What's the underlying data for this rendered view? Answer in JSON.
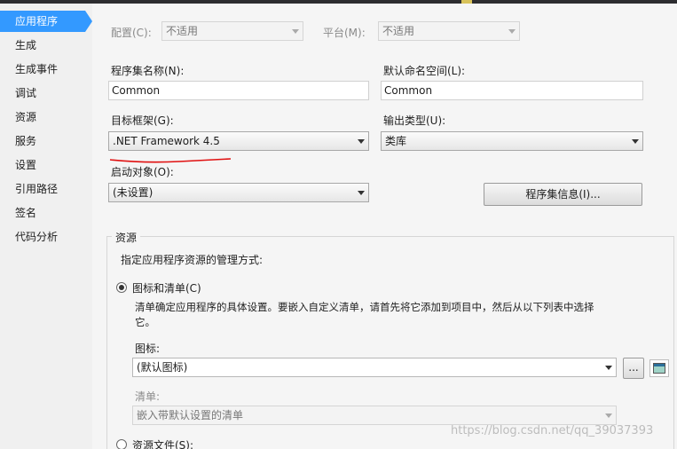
{
  "sidebar": {
    "items": [
      {
        "label": "应用程序"
      },
      {
        "label": "生成"
      },
      {
        "label": "生成事件"
      },
      {
        "label": "调试"
      },
      {
        "label": "资源"
      },
      {
        "label": "服务"
      },
      {
        "label": "设置"
      },
      {
        "label": "引用路径"
      },
      {
        "label": "签名"
      },
      {
        "label": "代码分析"
      }
    ]
  },
  "config": {
    "label": "配置(C):",
    "value": "不适用"
  },
  "platform": {
    "label": "平台(M):",
    "value": "不适用"
  },
  "assembly_name": {
    "label": "程序集名称(N):",
    "value": "Common"
  },
  "default_namespace": {
    "label": "默认命名空间(L):",
    "value": "Common"
  },
  "target_framework": {
    "label": "目标框架(G):",
    "value": ".NET Framework 4.5"
  },
  "output_type": {
    "label": "输出类型(U):",
    "value": "类库"
  },
  "startup_object": {
    "label": "启动对象(O):",
    "value": "(未设置)"
  },
  "assembly_info_button": "程序集信息(I)...",
  "resources": {
    "group_title": "资源",
    "description": "指定应用程序资源的管理方式:",
    "icon_manifest_option": "图标和清单(C)",
    "icon_manifest_hint_line1": "清单确定应用程序的具体设置。要嵌入自定义清单，请首先将它添加到项目中，然后从以下列表中选择",
    "icon_manifest_hint_line2": "它。",
    "icon_label": "图标:",
    "icon_value": "(默认图标)",
    "browse_button": "...",
    "manifest_label": "清单:",
    "manifest_value": "嵌入带默认设置的清单",
    "resource_file_option": "资源文件(S):"
  },
  "watermark": "https://blog.csdn.net/qq_39037393"
}
